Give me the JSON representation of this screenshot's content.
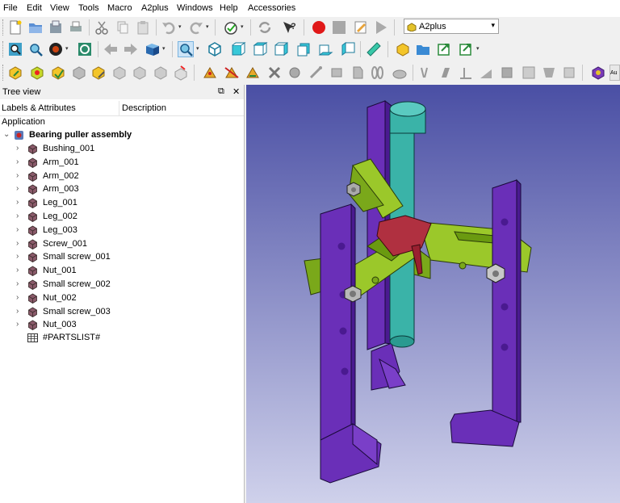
{
  "menu": [
    "File",
    "Edit",
    "View",
    "Tools",
    "Macro",
    "A2plus",
    "Windows",
    "Help",
    "Accessories"
  ],
  "workbench": {
    "selected": "A2plus"
  },
  "tree_panel": {
    "title": "Tree view",
    "columns": [
      "Labels & Attributes",
      "Description"
    ],
    "root": "Application",
    "document": "Bearing puller assembly",
    "items": [
      "Bushing_001",
      "Arm_001",
      "Arm_002",
      "Arm_003",
      "Leg_001",
      "Leg_002",
      "Leg_003",
      "Screw_001",
      "Small screw_001",
      "Nut_001",
      "Small screw_002",
      "Nut_002",
      "Small screw_003",
      "Nut_003"
    ],
    "partslist": "#PARTSLIST#",
    "float_button": "⧉",
    "close_button": "✕"
  },
  "toolbar_right_label": "Au",
  "icons": [
    "new-file",
    "open-folder",
    "save",
    "print",
    "cut",
    "copy",
    "paste",
    "undo",
    "redo",
    "macro-record-stop",
    "refresh",
    "whats-this",
    "record-macro",
    "stop-macro",
    "edit-macro",
    "run-macro",
    "fit-all",
    "fit-selection",
    "draw-style",
    "sync-view",
    "back",
    "forward",
    "std-views",
    "zoom",
    "isometric",
    "front",
    "top",
    "right",
    "measure",
    "a2plus-part",
    "open-folder",
    "import",
    "update"
  ],
  "colors": {
    "viewport_top": "#4a4fa4",
    "viewport_bottom": "#cfd1eb",
    "leg": "#6a2fb8",
    "arm": "#9bc82a",
    "screw": "#3ab3a8",
    "hub": "#b03040",
    "record_button": "#e01818"
  }
}
